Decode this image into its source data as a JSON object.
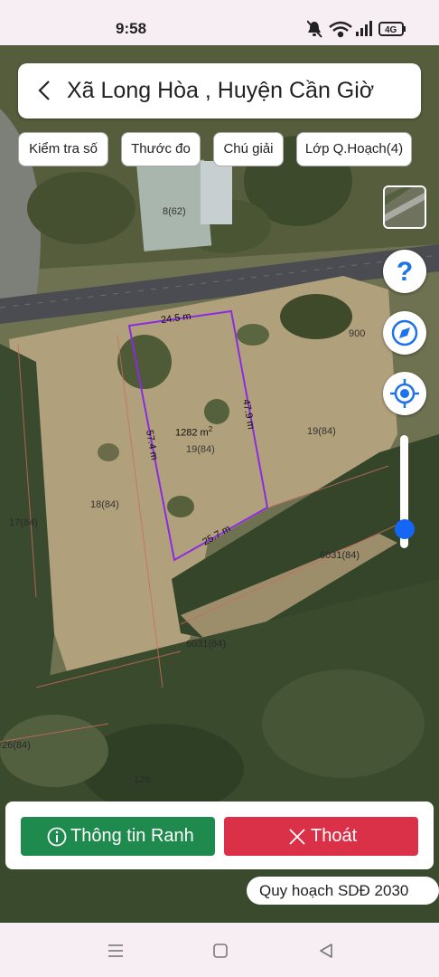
{
  "status": {
    "time": "9:58",
    "network": "4G"
  },
  "header": {
    "title": "Xã Long Hòa , Huyện Cần Giờ"
  },
  "toolbar": {
    "check_number": "Kiểm tra số",
    "ruler": "Thước đo",
    "legend": "Chú giải",
    "planning_layer": "Lớp Q.Hoạch(4)"
  },
  "map": {
    "parcel": {
      "area": "1282 m",
      "area_exp": "2",
      "number": "19(84)",
      "edges": {
        "top": "24.5 m",
        "right": "47.9 m",
        "bottom": "25.7 m",
        "left": "57.4 m"
      }
    },
    "labels": {
      "plot_8_62": "8(62)",
      "plot_19_84": "19(84)",
      "plot_18_84": "18(84)",
      "plot_17_84": "17(84)",
      "plot_6031_84_a": "6031(84)",
      "plot_6031_84_b": "6031(84)",
      "plot_900": "900",
      "plot_26_84": "26(84)",
      "plot_126": "126"
    },
    "zoom_level": 0.09
  },
  "actions": {
    "info": "Thông tin Ranh",
    "exit": "Thoát"
  },
  "plan_label": "Quy hoạch SDĐ 2030",
  "colors": {
    "info_button": "#1e8a4d",
    "exit_button": "#db3148",
    "parcel_outline": "#8a2be2",
    "accent": "#1565f6"
  },
  "icons": {
    "back": "chevron-left-icon",
    "help": "question-icon",
    "compass": "compass-icon",
    "locate": "locate-icon",
    "info": "info-icon",
    "close": "close-icon"
  }
}
